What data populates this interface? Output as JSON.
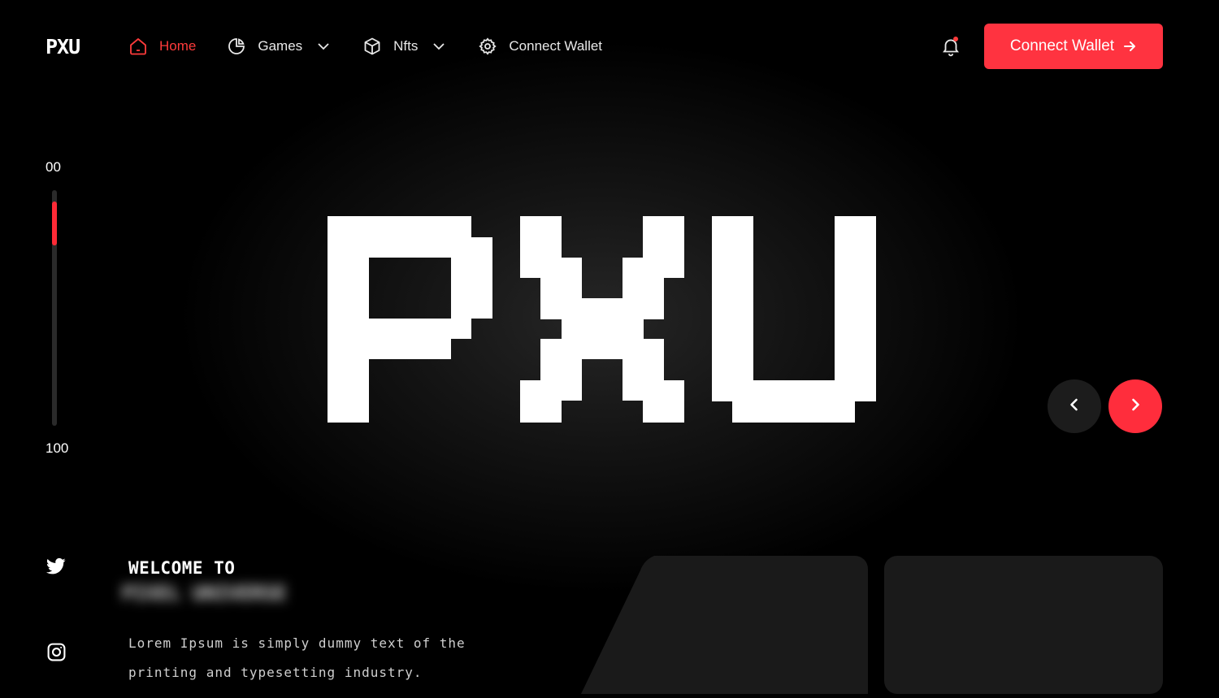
{
  "header": {
    "logo": "PXU",
    "nav": [
      {
        "label": "Home",
        "icon": "home-icon",
        "active": true
      },
      {
        "label": "Games",
        "icon": "pie-chart-icon",
        "dropdown": true
      },
      {
        "label": "Nfts",
        "icon": "cube-icon",
        "dropdown": true
      },
      {
        "label": "Connect Wallet",
        "icon": "gear-icon"
      }
    ],
    "cta_label": "Connect Wallet",
    "notification_icon": "bell-icon"
  },
  "progress": {
    "start_label": "00",
    "end_label": "100",
    "value": 0.1
  },
  "hero": {
    "logo_text": "PXU"
  },
  "carousel": {
    "prev_icon": "chevron-left-icon",
    "next_icon": "chevron-right-icon"
  },
  "welcome": {
    "heading": "WELCOME TO",
    "blurred_title": "PIXEL UNIVERSE",
    "description": "Lorem Ipsum is simply dummy text of the printing and typesetting industry."
  },
  "social": [
    {
      "icon": "twitter-icon"
    },
    {
      "icon": "instagram-icon"
    }
  ],
  "colors": {
    "accent": "#ff3340",
    "background": "#000000",
    "card": "#1a1a1a"
  }
}
